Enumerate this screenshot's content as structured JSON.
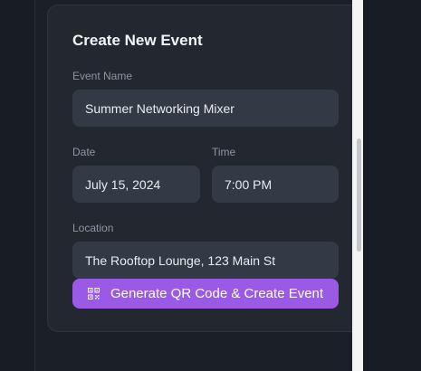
{
  "form": {
    "title": "Create New Event",
    "event_name": {
      "label": "Event Name",
      "value": "Summer Networking Mixer"
    },
    "date": {
      "label": "Date",
      "value": "July 15, 2024"
    },
    "time": {
      "label": "Time",
      "value": "7:00 PM"
    },
    "location": {
      "label": "Location",
      "value": "The Rooftop Lounge, 123 Main St"
    },
    "submit": {
      "label": "Generate QR Code & Create Event",
      "icon": "qr-code-icon"
    }
  },
  "colors": {
    "accent": "#9b5ae6",
    "card": "#232730",
    "input": "#343946",
    "background": "#181c25"
  }
}
